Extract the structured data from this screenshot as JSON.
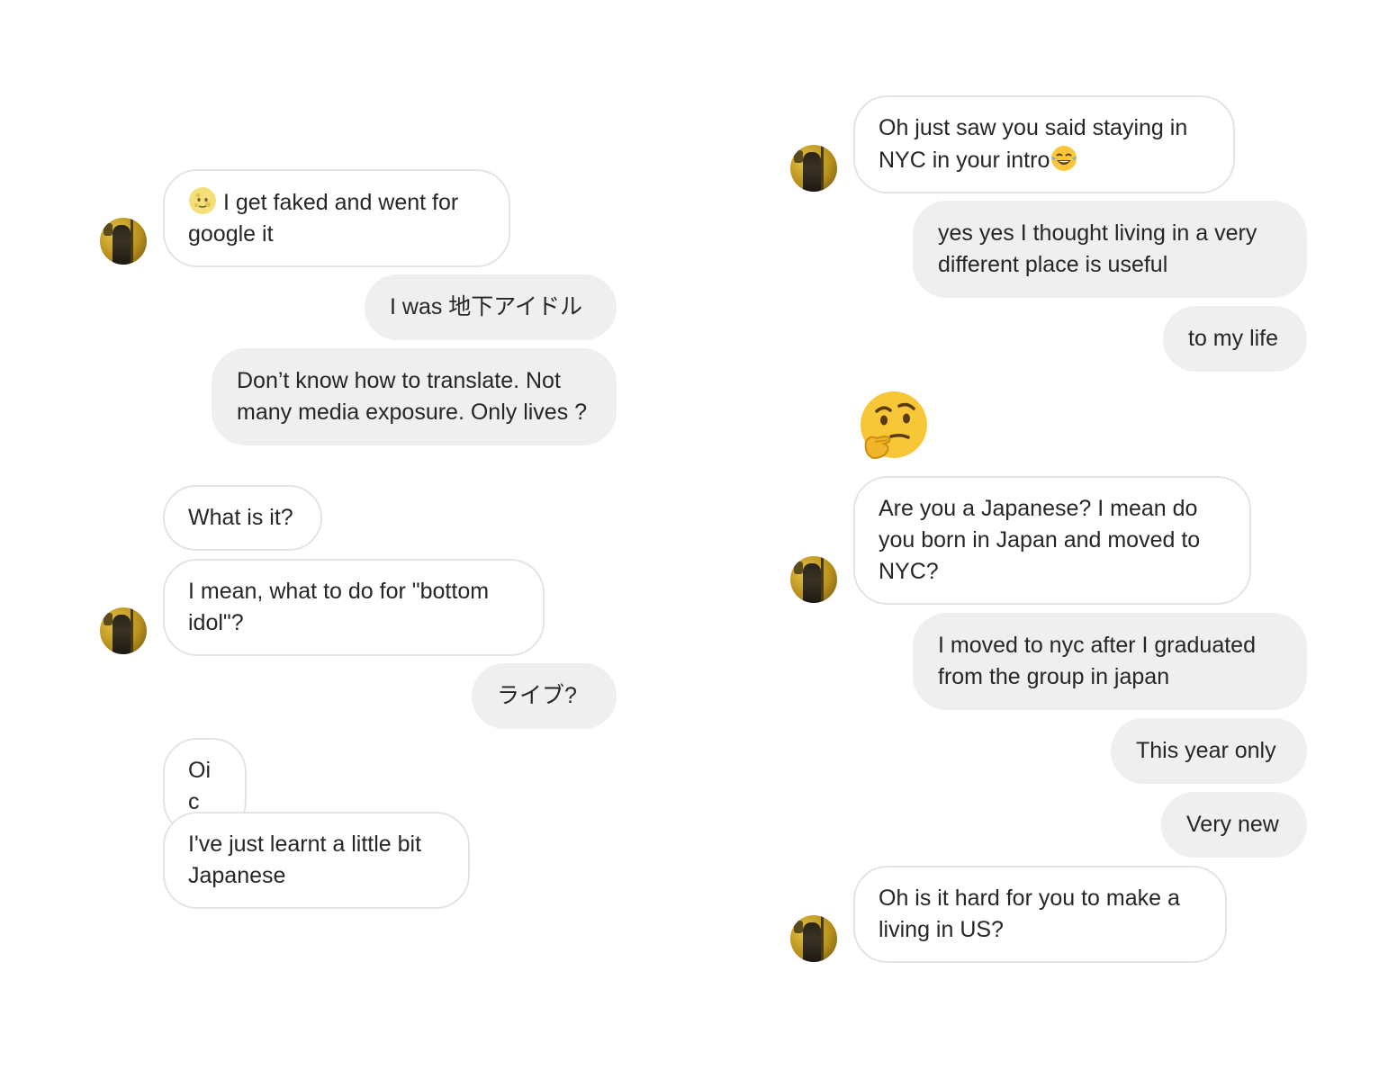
{
  "left_conversation": {
    "messages": [
      {
        "sender": "them",
        "text": "I get faked and went for google it",
        "prefix_emoji": "moon-face-emoji"
      },
      {
        "sender": "me",
        "text": "I was 地下アイドル"
      },
      {
        "sender": "me",
        "text": "Don’t know how to translate. Not many media exposure. Only lives ?"
      },
      {
        "sender": "them",
        "text": "What is it?"
      },
      {
        "sender": "them",
        "text": "I mean, what to do for \"bottom idol\"?"
      },
      {
        "sender": "me",
        "text": "ライブ?"
      },
      {
        "sender": "them",
        "text": "Oic"
      },
      {
        "sender": "them",
        "text": "I've just learnt a little bit Japanese"
      }
    ]
  },
  "right_conversation": {
    "messages": [
      {
        "sender": "them",
        "text": "Oh just saw you said staying in NYC  in your intro",
        "suffix_emoji": "tears-of-joy-emoji"
      },
      {
        "sender": "me",
        "text": "yes yes I thought living in a very different place is useful"
      },
      {
        "sender": "me",
        "text": "to my life"
      },
      {
        "sender": "them",
        "emoji": "thinking-face-emoji"
      },
      {
        "sender": "them",
        "text": "Are you a Japanese? I mean do you born in Japan and moved to NYC?"
      },
      {
        "sender": "me",
        "text": "I moved to nyc after I graduated from the group in japan"
      },
      {
        "sender": "me",
        "text": "This year only"
      },
      {
        "sender": "me",
        "text": "Very new"
      },
      {
        "sender": "them",
        "text": "Oh is it hard for you to make a living in US?"
      }
    ]
  },
  "colors": {
    "incoming_bubble_bg": "#ffffff",
    "incoming_bubble_border": "#e4e4e4",
    "outgoing_bubble_bg": "#efefef",
    "text": "#262626",
    "emoji_yellow": "#f7c738"
  }
}
